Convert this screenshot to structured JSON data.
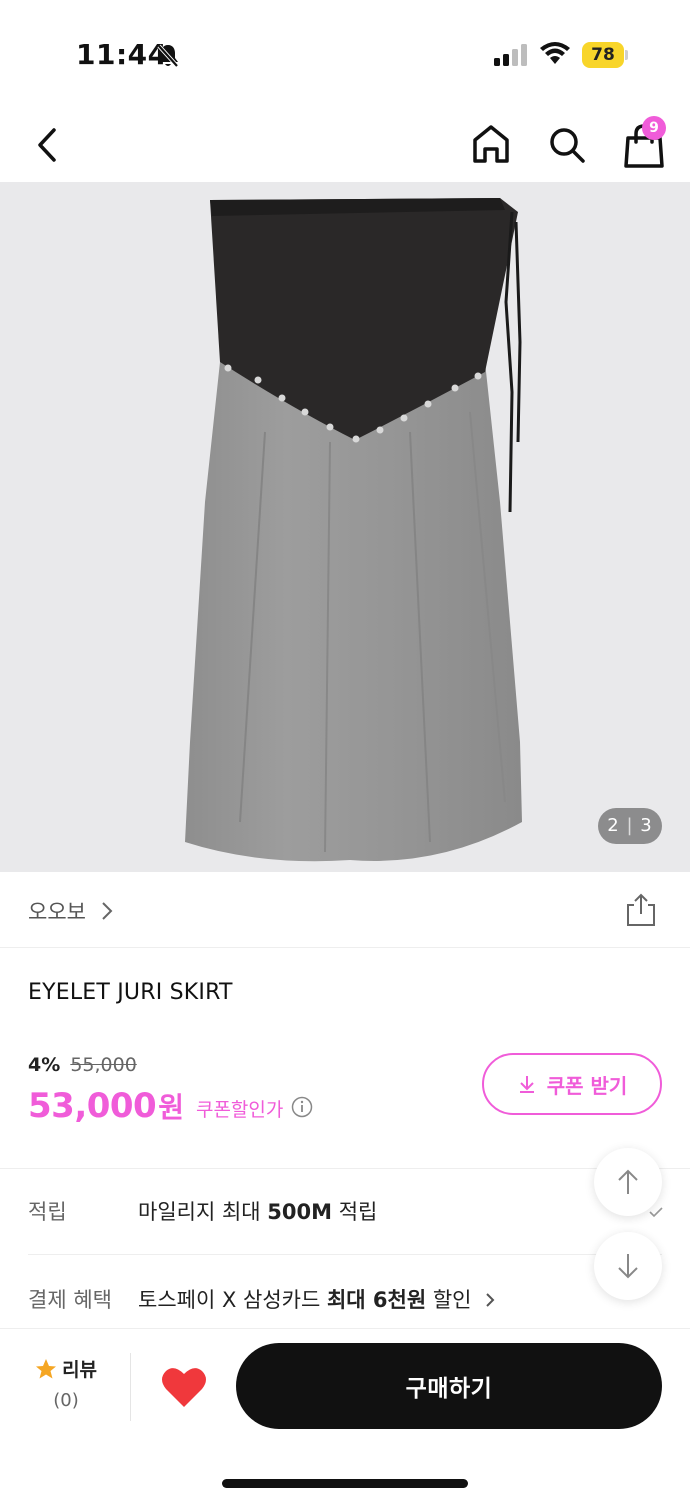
{
  "status_bar": {
    "time": "11:44",
    "battery": "78",
    "icons": [
      "bell-slash-icon",
      "signal-icon",
      "wifi-icon",
      "battery-icon"
    ],
    "battery_color": "#f8d52a"
  },
  "nav": {
    "icons": [
      "back-icon",
      "home-icon",
      "search-icon",
      "shopping-bag-icon"
    ],
    "cart_count": "9",
    "badge_color": "#f05cd9"
  },
  "gallery": {
    "counter_current": "2",
    "counter_total": "3"
  },
  "brand": {
    "name": "오오보"
  },
  "product": {
    "title": "EYELET JURI SKIRT",
    "discount_rate": "4%",
    "original_price": "55,000",
    "sale_price": "53,000",
    "price_unit": "원",
    "coupon_price_label": "쿠폰할인가",
    "coupon_button": "쿠폰 받기",
    "accent_color": "#f05cd9"
  },
  "info": {
    "points_label": "적립",
    "points_prefix": "마일리지 최대 ",
    "points_bold": "500M",
    "points_suffix": " 적립",
    "payment_label": "결제 혜택",
    "payment_prefix": "토스페이 X 삼성카드 ",
    "payment_bold": "최대 6천원",
    "payment_suffix": " 할인"
  },
  "bottom_bar": {
    "review_label": "리뷰",
    "review_count": "(0)",
    "buy_button": "구매하기"
  }
}
